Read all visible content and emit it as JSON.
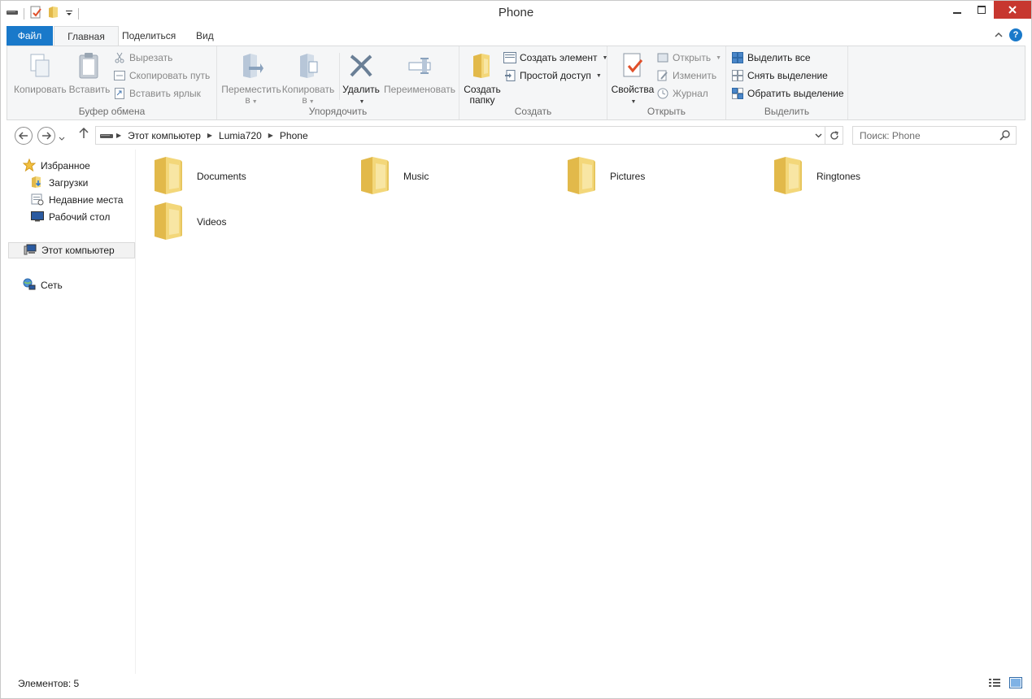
{
  "window": {
    "title": "Phone",
    "minimize_icon": "minimize-icon",
    "maximize_icon": "maximize-icon",
    "close_icon": "close-icon"
  },
  "tabs": [
    {
      "label": "Файл"
    },
    {
      "label": "Главная"
    },
    {
      "label": "Поделиться"
    },
    {
      "label": "Вид"
    }
  ],
  "ribbon": {
    "clipboard": {
      "label": "Буфер обмена",
      "copy": "Копировать",
      "paste": "Вставить",
      "cut": "Вырезать",
      "copy_path": "Скопировать путь",
      "paste_shortcut": "Вставить ярлык"
    },
    "organize": {
      "label": "Упорядочить",
      "move_to": "Переместить",
      "move_to_sub": "в",
      "copy_to": "Копировать",
      "copy_to_sub": "в",
      "delete": "Удалить",
      "rename": "Переименовать"
    },
    "new": {
      "label": "Создать",
      "new_folder_1": "Создать",
      "new_folder_2": "папку",
      "new_item": "Создать элемент",
      "easy_access": "Простой доступ"
    },
    "open": {
      "label": "Открыть",
      "properties": "Свойства",
      "open": "Открыть",
      "edit": "Изменить",
      "history": "Журнал"
    },
    "select": {
      "label": "Выделить",
      "select_all": "Выделить все",
      "select_none": "Снять выделение",
      "invert": "Обратить выделение"
    }
  },
  "address": {
    "crumbs": [
      "Этот компьютер",
      "Lumia720",
      "Phone"
    ]
  },
  "search": {
    "placeholder": "Поиск: Phone"
  },
  "navpane": {
    "favorites": "Избранное",
    "downloads": "Загрузки",
    "recent": "Недавние места",
    "desktop": "Рабочий стол",
    "this_pc": "Этот компьютер",
    "network": "Сеть"
  },
  "folders": [
    {
      "name": "Documents"
    },
    {
      "name": "Music"
    },
    {
      "name": "Pictures"
    },
    {
      "name": "Ringtones"
    },
    {
      "name": "Videos"
    }
  ],
  "status": {
    "items": "Элементов: 5"
  },
  "colors": {
    "accent": "#1979ca",
    "folder": "#f3d77a",
    "close": "#c7372f"
  }
}
